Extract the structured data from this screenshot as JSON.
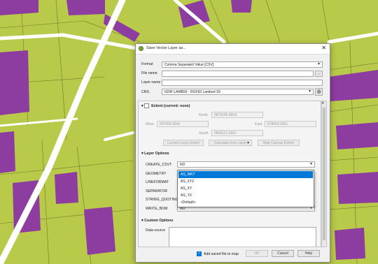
{
  "dialog": {
    "title": "Save Vector Layer as...",
    "close_glyph": "✕",
    "format_label": "Format",
    "format_value": "Comma Separated Value [CSV]",
    "filename_label": "File name",
    "filename_value": "",
    "browse_label": "...",
    "layername_label": "Layer name",
    "layername_value": "",
    "crs_label": "CRS",
    "crs_value": "IGNF:LAMB93 - RGF93 Lambert 93",
    "crs_icon": "globe-icon",
    "extent": {
      "title": "Extent (current: none)",
      "north_label": "North",
      "north_value": "6879245.6654",
      "west_label": "West",
      "west_value": "647993.0646",
      "east_label": "East",
      "east_value": "678063.0951",
      "south_label": "South",
      "south_value": "6858121.9361",
      "current_layer_btn": "Current Layer Extent",
      "calc_from_layer_btn": "Calculate from Layer",
      "map_canvas_btn": "Map Canvas Extent"
    },
    "layer_options": {
      "title": "Layer Options",
      "rows": [
        {
          "label": "CREATE_CSVT",
          "value": "NO"
        },
        {
          "label": "GEOMETRY",
          "value": ""
        },
        {
          "label": "LINEFORMAT",
          "value": ""
        },
        {
          "label": "SEPARATOR",
          "value": ""
        },
        {
          "label": "STRING_QUOTING",
          "value": ""
        },
        {
          "label": "WRITE_BOM",
          "value": "NO"
        }
      ],
      "geometry_options": [
        "AS_WKT",
        "AS_XYZ",
        "AS_XY",
        "AS_YX",
        "<Default>"
      ],
      "geometry_selected": "AS_WKT"
    },
    "custom_options": {
      "title": "Custom Options",
      "datasource_label": "Data source"
    },
    "add_to_map_label": "Add saved file to map",
    "add_to_map_checked": true,
    "ok_label": "OK",
    "cancel_label": "Cancel",
    "help_label": "Help"
  },
  "colors": {
    "map_parcel": "#b9c94a",
    "map_building": "#8c3d9f",
    "map_road": "#ffffff",
    "selection": "#0078d7"
  }
}
